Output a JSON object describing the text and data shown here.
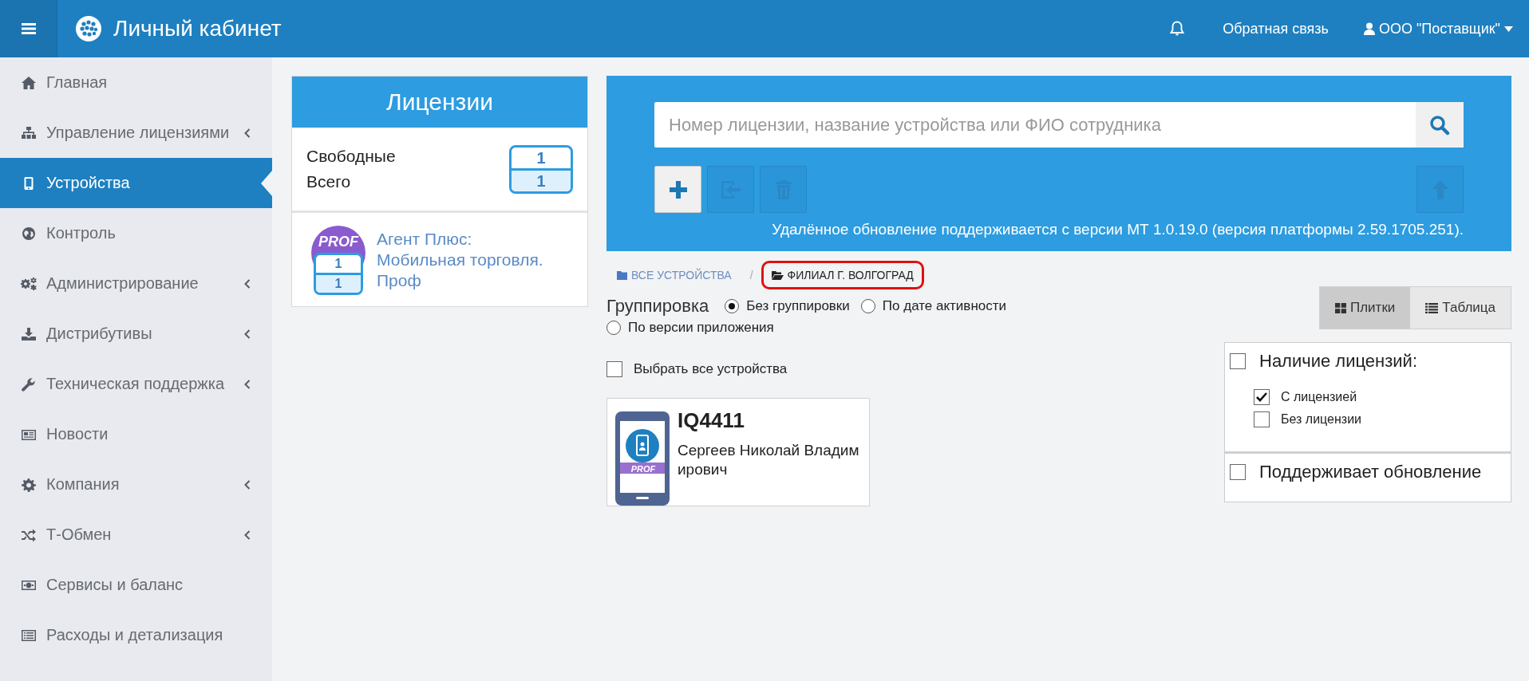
{
  "header": {
    "title": "Личный кабинет",
    "feedback": "Обратная связь",
    "user": "ООО \"Поставщик\""
  },
  "sidebar": {
    "items": [
      {
        "label": "Главная",
        "selected": false,
        "has_submenu": false
      },
      {
        "label": "Управление лицензиями",
        "selected": false,
        "has_submenu": true
      },
      {
        "label": "Устройства",
        "selected": true,
        "has_submenu": false
      },
      {
        "label": "Контроль",
        "selected": false,
        "has_submenu": false
      },
      {
        "label": "Администрирование",
        "selected": false,
        "has_submenu": true
      },
      {
        "label": "Дистрибутивы",
        "selected": false,
        "has_submenu": true
      },
      {
        "label": "Техническая поддержка",
        "selected": false,
        "has_submenu": true
      },
      {
        "label": "Новости",
        "selected": false,
        "has_submenu": false
      },
      {
        "label": "Компания",
        "selected": false,
        "has_submenu": true
      },
      {
        "label": "Т-Обмен",
        "selected": false,
        "has_submenu": true
      },
      {
        "label": "Сервисы и баланс",
        "selected": false,
        "has_submenu": false
      },
      {
        "label": "Расходы и детализация",
        "selected": false,
        "has_submenu": false
      }
    ]
  },
  "licenses": {
    "title": "Лицензии",
    "labels": [
      "Свободные",
      "Всего"
    ],
    "free": "1",
    "total": "1",
    "products": [
      {
        "badge": "PROF",
        "free": "1",
        "total": "1",
        "name": "Агент Плюс: Мобильная торговля. Проф"
      }
    ]
  },
  "search": {
    "placeholder": "Номер лицензии, название устройства или ФИО сотрудника"
  },
  "toolbar": [
    {
      "kind": "add",
      "disabled": false
    },
    {
      "kind": "move",
      "disabled": true
    },
    {
      "kind": "delete",
      "disabled": true
    },
    {
      "kind": "upload",
      "disabled": true
    }
  ],
  "update_note": "Удалённое обновление поддерживается с версии МТ 1.0.19.0 (версия платформы 2.59.1705.251).",
  "breadcrumbs": [
    {
      "label": "ВСЕ УСТРОЙСТВА",
      "selected": false
    },
    {
      "label": "ФИЛИАЛ Г. ВОЛГОГРАД",
      "selected": true
    }
  ],
  "breadcrumb_separator": "/",
  "grouping": {
    "label": "Группировка",
    "options": [
      {
        "label": "Без группировки",
        "selected": true
      },
      {
        "label": "По дате активности",
        "selected": false
      },
      {
        "label": "По версии приложения",
        "selected": false
      }
    ]
  },
  "select_all": {
    "label": "Выбрать все устройства",
    "checked": false
  },
  "devices": [
    {
      "id": "IQ4411",
      "owner": "Сергеев Николай Владимирович",
      "badge": "PROF"
    }
  ],
  "view_toggle": [
    {
      "label": "Плитки",
      "selected": true,
      "kind": "tiles"
    },
    {
      "label": "Таблица",
      "selected": false,
      "kind": "table"
    }
  ],
  "filters": [
    {
      "label": "Наличие лицензий:",
      "checked": false,
      "options": [
        {
          "label": "С лицензией",
          "checked": true
        },
        {
          "label": "Без лицензии",
          "checked": false
        }
      ]
    },
    {
      "label": "Поддерживает обновление",
      "checked": false
    }
  ]
}
